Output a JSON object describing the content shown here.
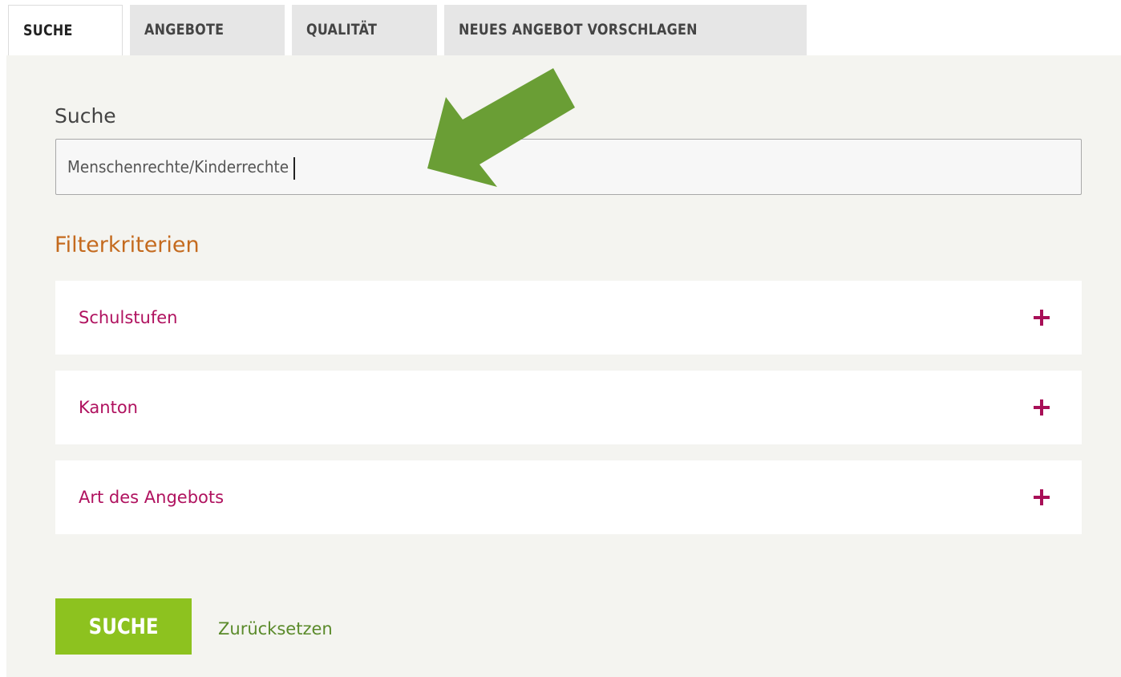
{
  "tabs": [
    {
      "label": "SUCHE",
      "active": true
    },
    {
      "label": "ANGEBOTE",
      "active": false
    },
    {
      "label": "QUALITÄT",
      "active": false
    },
    {
      "label": "NEUES ANGEBOT VORSCHLAGEN",
      "active": false
    }
  ],
  "search": {
    "label": "Suche",
    "value": "Menschenrechte/Kinderrechte"
  },
  "filters": {
    "heading": "Filterkriterien",
    "items": [
      {
        "label": "Schulstufen",
        "icon": "plus-icon"
      },
      {
        "label": "Kanton",
        "icon": "plus-icon"
      },
      {
        "label": "Art des Angebots",
        "icon": "plus-icon"
      }
    ]
  },
  "actions": {
    "search_button": "SUCHE",
    "reset_link": "Zurücksetzen"
  },
  "annotation": {
    "icon": "arrow-icon",
    "color": "#6a9e35"
  },
  "colors": {
    "accent_magenta": "#b0125f",
    "heading_orange": "#c46a1e",
    "button_green": "#8dc21f",
    "panel_bg": "#f4f4f0"
  }
}
